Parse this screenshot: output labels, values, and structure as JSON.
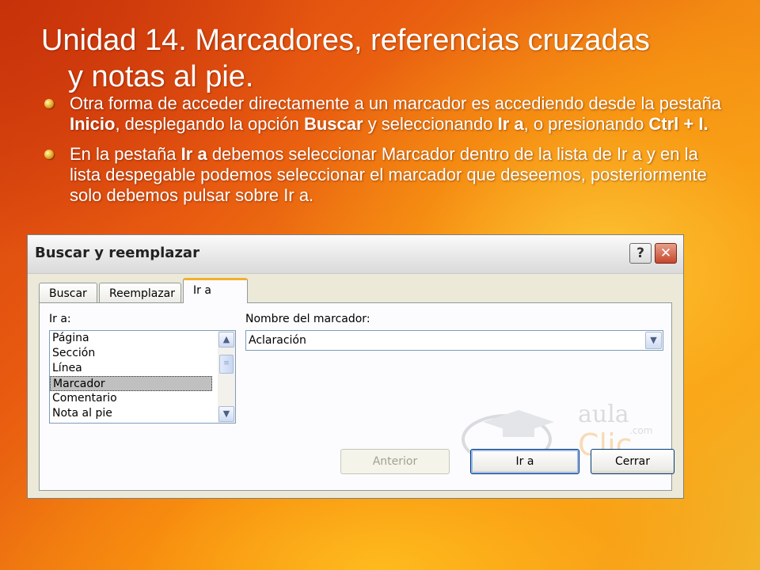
{
  "slide": {
    "title_line1": "Unidad 14. Marcadores, referencias cruzadas",
    "title_line2": "y notas al pie.",
    "bullets": [
      {
        "t1": "Otra forma de acceder directamente a un marcador es accediendo desde la pestaña ",
        "b1": "Inicio",
        "t2": ", desplegando la opción ",
        "b2": "Buscar",
        "t3": " y seleccionando ",
        "b3": "Ir a",
        "t4": ", o presionando ",
        "b4": "Ctrl + I."
      },
      {
        "t1": "En la pestaña ",
        "b1": "Ir a",
        "t2": " debemos seleccionar Marcador dentro de la lista de Ir a y en la lista despegable podemos seleccionar el marcador que deseemos, posteriormente solo debemos pulsar sobre Ir a."
      }
    ]
  },
  "dialog": {
    "title": "Buscar y reemplazar",
    "help_glyph": "?",
    "close_glyph": "✕",
    "tabs": [
      "Buscar",
      "Reemplazar",
      "Ir a"
    ],
    "active_tab": "Ir a",
    "goto_label": "Ir a:",
    "goto_items": [
      "Página",
      "Sección",
      "Línea",
      "Marcador",
      "Comentario",
      "Nota al pie"
    ],
    "selected_item": "Marcador",
    "bookmark_label": "Nombre del marcador:",
    "bookmark_value": "Aclaración",
    "buttons": {
      "previous": "Anterior",
      "goto": "Ir a",
      "close": "Cerrar"
    },
    "watermark_text_1": "aula",
    "watermark_text_2": "Clic",
    "watermark_text_3": ".com"
  }
}
